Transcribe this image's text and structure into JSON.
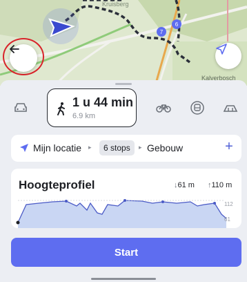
{
  "map": {
    "town_label": "Kruisberg",
    "place_label": "Kalverbosch",
    "back_icon": "arrow-left-icon",
    "location_icon": "navigation-arrow-icon",
    "route_color": "#2b2f3a",
    "pin_labels": [
      "7",
      "6"
    ]
  },
  "modes": {
    "selected": "walking",
    "duration": "1 u 44 min",
    "distance": "6.9 km",
    "items": [
      "car-icon",
      "walking-icon",
      "bicycle-icon",
      "transit-icon",
      "more-icon"
    ]
  },
  "route": {
    "from": "Mijn locatie",
    "stops": "6 stops",
    "to": "Gebouw",
    "add": "+"
  },
  "profile": {
    "title": "Hoogteprofiel",
    "descent": "61 m",
    "ascent": "110 m",
    "tick_high": "112",
    "tick_low": "61"
  },
  "start_label": "Start",
  "colors": {
    "accent": "#5e6df0",
    "profile_fill": "#c9d6f3",
    "profile_line": "#4a5ac6"
  }
}
